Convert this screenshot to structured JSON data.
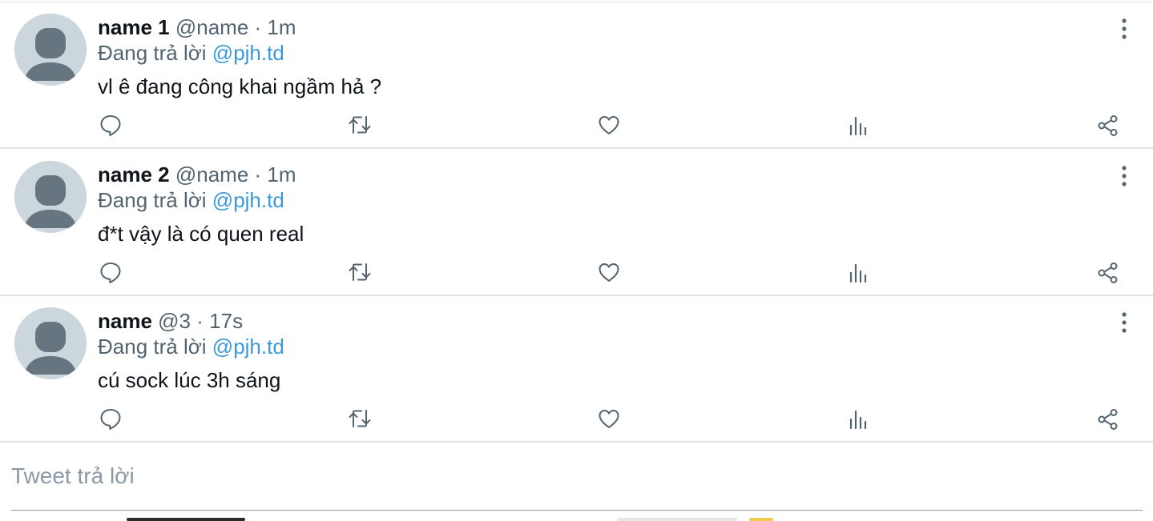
{
  "tweets": [
    {
      "display_name": "name 1",
      "handle": "@name",
      "separator": "·",
      "time": "1m",
      "reply_prefix": "Đang trả lời",
      "reply_to": "@pjh.td",
      "text": "vl ê đang công khai ngầm hả ?"
    },
    {
      "display_name": "name 2",
      "handle": "@name",
      "separator": "·",
      "time": "1m",
      "reply_prefix": "Đang trả lời",
      "reply_to": "@pjh.td",
      "text": "đ*t vậy là có quen real"
    },
    {
      "display_name": "name",
      "handle": "@3",
      "separator": "·",
      "time": "17s",
      "reply_prefix": "Đang trả lời",
      "reply_to": "@pjh.td",
      "text": "cú sock lúc 3h sáng"
    }
  ],
  "actions": [
    "reply-icon",
    "retweet-icon",
    "like-icon",
    "stats-icon",
    "share-icon"
  ],
  "composer": {
    "placeholder": "Tweet trả lời"
  },
  "colors": {
    "accent": "#3a9ad9",
    "muted": "#536471",
    "icon": "#536471",
    "divider": "#e1e4e6"
  }
}
